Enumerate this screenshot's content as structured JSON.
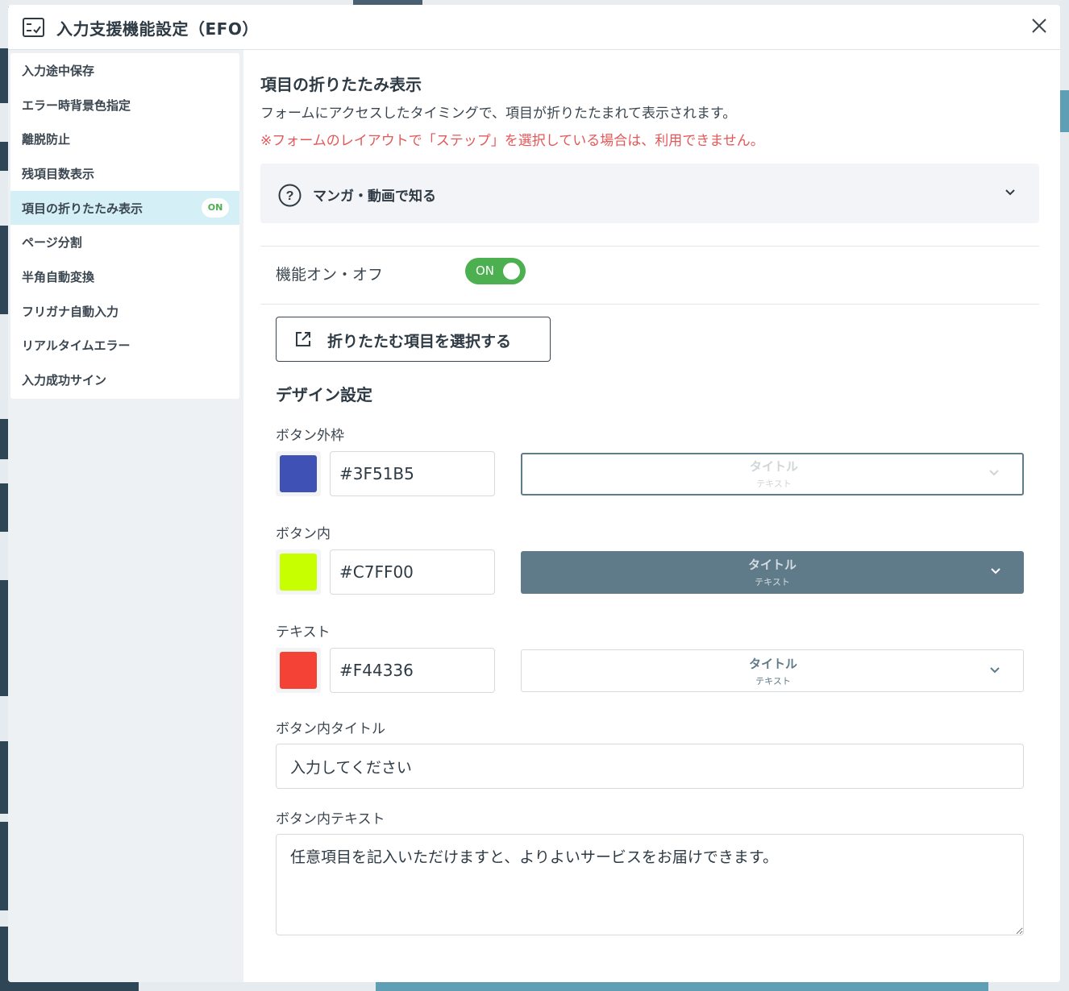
{
  "modal": {
    "title": "入力支援機能設定（EFO）"
  },
  "sidebar": {
    "items": [
      {
        "label": "入力途中保存"
      },
      {
        "label": "エラー時背景色指定"
      },
      {
        "label": "離脱防止"
      },
      {
        "label": "残項目数表示"
      },
      {
        "label": "項目の折りたたみ表示",
        "badge": "ON",
        "active": true
      },
      {
        "label": "ページ分割"
      },
      {
        "label": "半角自動変換"
      },
      {
        "label": "フリガナ自動入力"
      },
      {
        "label": "リアルタイムエラー"
      },
      {
        "label": "入力成功サイン"
      }
    ]
  },
  "main": {
    "title": "項目の折りたたみ表示",
    "description": "フォームにアクセスしたタイミングで、項目が折りたたまれて表示されます。",
    "warning": "※フォームのレイアウトで「ステップ」を選択している場合は、利用できません。",
    "accordion_label": "マンガ・動画で知る",
    "toggle_label": "機能オン・オフ",
    "toggle_state": "ON",
    "select_items_button": "折りたたむ項目を選択する",
    "design_title": "デザイン設定",
    "colors": [
      {
        "label": "ボタン外枠",
        "hex": "#3F51B5",
        "preview_title": "タイトル",
        "preview_text": "テキスト"
      },
      {
        "label": "ボタン内",
        "hex": "#C7FF00",
        "preview_title": "タイトル",
        "preview_text": "テキスト"
      },
      {
        "label": "テキスト",
        "hex": "#F44336",
        "preview_title": "タイトル",
        "preview_text": "テキスト"
      }
    ],
    "button_title_label": "ボタン内タイトル",
    "button_title_value": "入力してください",
    "button_text_label": "ボタン内テキスト",
    "button_text_value": "任意項目を記入いただけますと、よりよいサービスをお届けできます。"
  },
  "theme": {
    "accent_green": "#4caf50",
    "active_bg": "#d4eff5",
    "warning_red": "#e55757",
    "preview_dark": "#5f7a88",
    "preview_border": "#5f7a88"
  }
}
